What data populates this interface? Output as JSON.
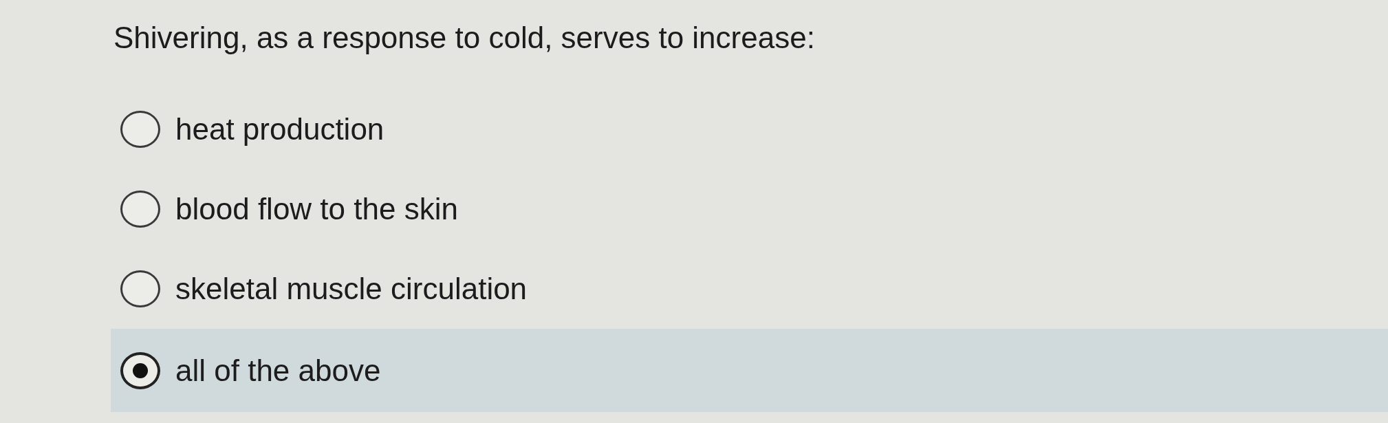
{
  "question": "Shivering, as a response to cold, serves to increase:",
  "options": [
    {
      "label": "heat production",
      "selected": false
    },
    {
      "label": "blood flow to the skin",
      "selected": false
    },
    {
      "label": "skeletal muscle circulation",
      "selected": false
    },
    {
      "label": "all of the above",
      "selected": true
    }
  ]
}
